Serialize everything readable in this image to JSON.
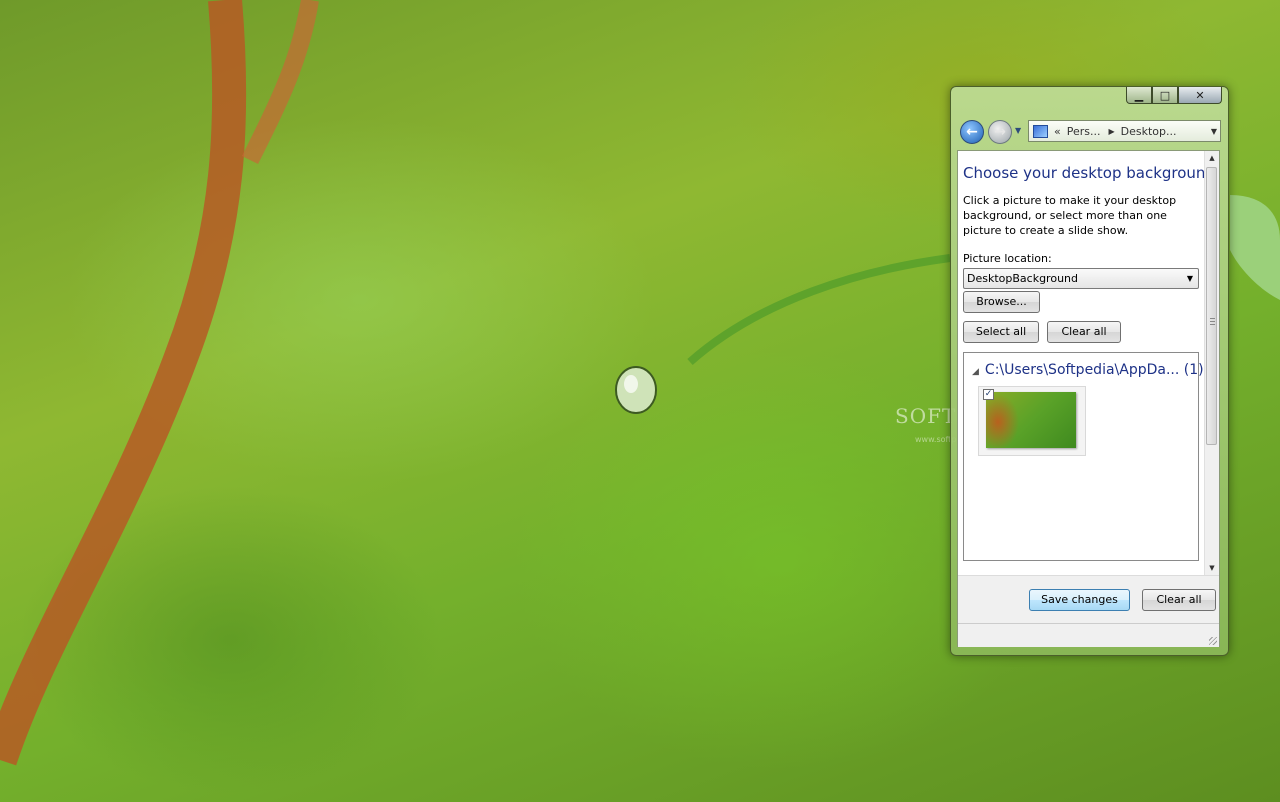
{
  "window": {
    "caption": {
      "minimize_glyph": "▁",
      "maximize_glyph": "□",
      "close_glyph": "✕"
    },
    "address": {
      "prefix": "«",
      "crumbs": [
        "Pers...",
        "Desktop..."
      ],
      "separator": "▶",
      "dropdown_glyph": "▼"
    },
    "nav": {
      "back_glyph": "←",
      "forward_glyph": "→",
      "history_glyph": "▼"
    }
  },
  "page": {
    "title": "Choose your desktop background",
    "description": "Click a picture to make it your desktop background, or select more than one picture to create a slide show.",
    "picture_location_label": "Picture location:",
    "picture_location_value": "DesktopBackground",
    "dropdown_glyph": "▼",
    "browse_label": "Browse...",
    "select_all_label": "Select all",
    "clear_all_label": "Clear all",
    "group": {
      "expand_glyph": "◢",
      "header": "C:\\Users\\Softpedia\\AppDa... (1)",
      "items": [
        {
          "checked": true,
          "check_glyph": "✓"
        }
      ]
    }
  },
  "scrollbar": {
    "up_glyph": "▲",
    "down_glyph": "▼"
  },
  "footer": {
    "save_label": "Save changes",
    "clear_all_label": "Clear all"
  },
  "watermark": {
    "text": "SOFTPEDIA",
    "url": "www.softpedia.com"
  },
  "colors": {
    "accent_blue": "#1e3287",
    "window_frame": "#8cb95a",
    "focused_button": "#3c7fb1"
  }
}
